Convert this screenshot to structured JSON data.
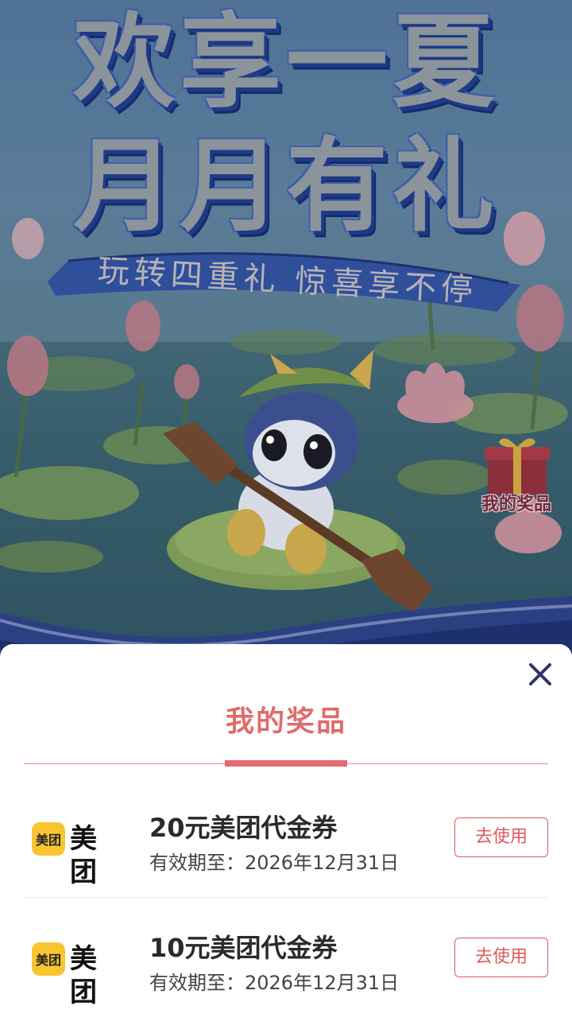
{
  "banner": {
    "title_line1": "欢享一夏",
    "title_line2": "月月有礼",
    "ribbon": "玩转四重礼 惊喜享不停",
    "my_prizes_entry": "我的奖品"
  },
  "sheet": {
    "title": "我的奖品",
    "prizes": [
      {
        "brand": "美团",
        "brand_badge": "美团",
        "name": "20元美团代金券",
        "expiry": "有效期至：2026年12月31日",
        "action": "去使用"
      },
      {
        "brand": "美团",
        "brand_badge": "美团",
        "name": "10元美团代金券",
        "expiry": "有效期至：2026年12月31日",
        "action": "去使用"
      }
    ]
  },
  "colors": {
    "accent": "#e06b6b",
    "button_border": "#e15959",
    "brand_yellow": "#f8c531",
    "close_icon": "#2f3563"
  },
  "icons": [
    "close-icon",
    "gift-box-icon",
    "meituan-logo",
    "mascot-dragon"
  ]
}
